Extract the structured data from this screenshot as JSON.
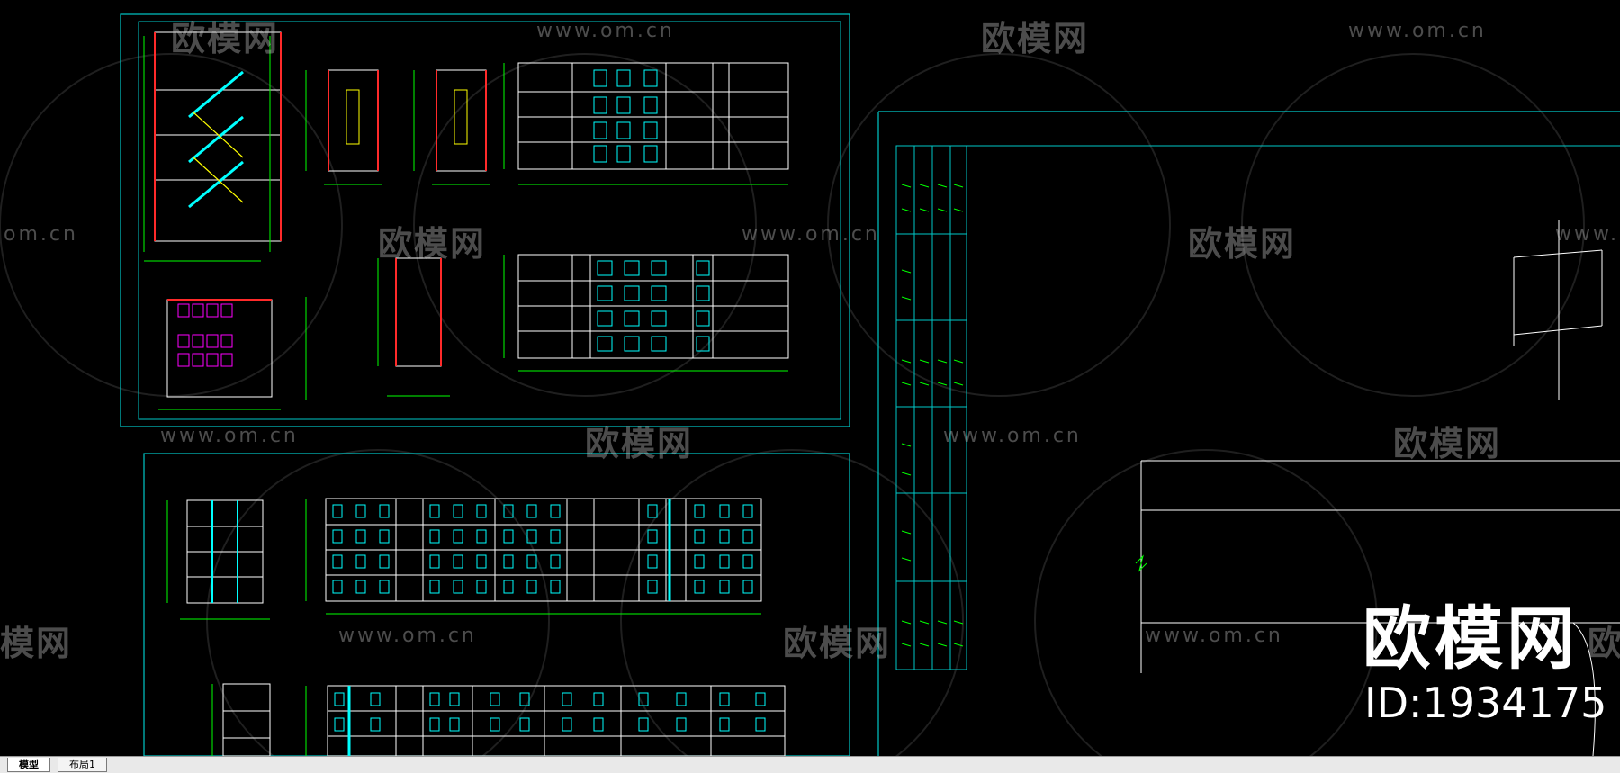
{
  "tabs": [
    {
      "label": "模型",
      "active": true
    },
    {
      "label": "布局1",
      "active": false
    }
  ],
  "watermark": {
    "logo_text": "欧模网",
    "url_text": "www.om.cn",
    "partial_url_left": "om.cn",
    "partial_url_right": "www.",
    "partial_logo_left": "模网",
    "partial_logo_right": "欧"
  },
  "brand": {
    "name": "欧模网",
    "id_text": "ID:1934175"
  },
  "colors": {
    "background": "#000000",
    "frame": "#00c8c8",
    "line_white": "#ffffff",
    "line_green": "#00ff00",
    "line_cyan": "#00ffff",
    "line_red": "#ff2a2a",
    "line_yellow": "#ffff00",
    "line_magenta": "#ff00ff",
    "tabbar": "#e9e9e9"
  }
}
